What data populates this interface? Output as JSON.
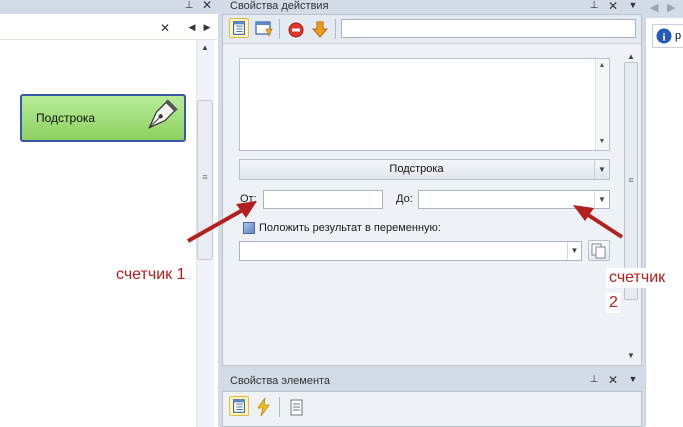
{
  "left_panel": {
    "close_glyph": "✕",
    "prev_glyph": "◀",
    "next_glyph": "▶",
    "pin_glyph": "📌",
    "node": {
      "label": "Подстрока",
      "icon": "pen-nib-icon",
      "fill_color": "#9fdc77",
      "border_color": "#3858a8"
    }
  },
  "action_properties": {
    "title": "Свойства действия",
    "toolbar": {
      "icons": [
        "table-view-icon",
        "window-icon",
        "stop-icon",
        "arrow-down-icon"
      ],
      "search_value": ""
    },
    "textarea_value": "",
    "function_select": "Подстрока",
    "from_label": "От:",
    "from_value": "",
    "to_label": "До:",
    "to_value": "",
    "checkbox_label": "Положить результат в переменную:",
    "variable_value": ""
  },
  "element_properties": {
    "title": "Свойства элемента",
    "toolbar_icons": [
      "table-view-icon",
      "lightning-icon",
      "list-icon"
    ]
  },
  "right_panel": {
    "tab_label": "р",
    "icon": "info-icon"
  },
  "annotations": {
    "counter1": "счетчик 1",
    "counter2_line1": "счетчик",
    "counter2_line2": "2",
    "color": "#b3201d"
  }
}
